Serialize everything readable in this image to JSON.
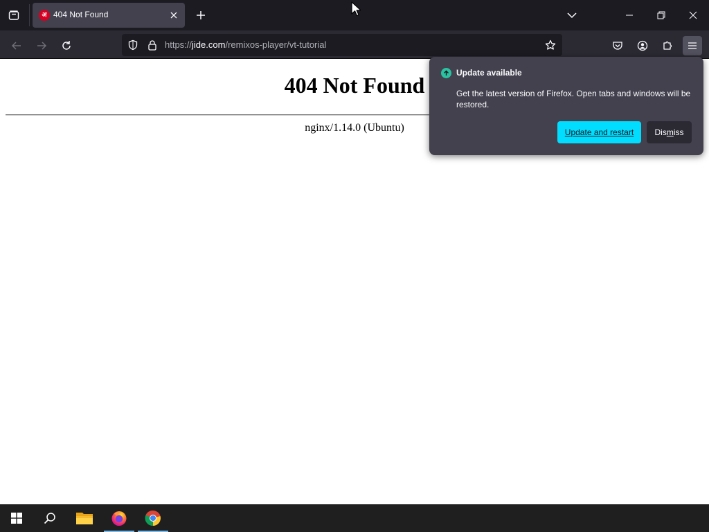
{
  "browser": {
    "tab": {
      "title": "404 Not Found",
      "favicon_glyph": "अ",
      "favicon_color": "#d70022"
    },
    "url": {
      "prefix": "https://",
      "host": "jide.com",
      "path": "/remixos-player/vt-tutorial"
    },
    "icons": {
      "tab_list": "tab-list-icon",
      "close_tab": "close-icon",
      "new_tab": "plus-icon",
      "list_all_tabs": "chevron-down-icon",
      "minimize": "minimize-icon",
      "restore": "restore-icon",
      "close_window": "close-icon",
      "back": "arrow-left-icon",
      "forward": "arrow-right-icon",
      "reload": "reload-icon",
      "tracking_protection": "shield-icon",
      "site_security": "lock-icon",
      "bookmark": "star-icon",
      "pocket": "pocket-icon",
      "account": "account-icon",
      "extensions": "puzzle-icon",
      "menu": "hamburger-icon"
    }
  },
  "page": {
    "heading": "404 Not Found",
    "server": "nginx/1.14.0 (Ubuntu)"
  },
  "update_panel": {
    "title": "Update available",
    "description": "Get the latest version of Firefox. Open tabs and windows will be restored.",
    "primary_button": "Update and restart",
    "secondary_button_pre": "Dis",
    "secondary_button_accel": "m",
    "secondary_button_post": "iss",
    "accent_color": "#00ddff",
    "icon_color": "#2ac3a2"
  },
  "taskbar": {
    "items": [
      {
        "name": "start",
        "icon": "windows-logo-icon"
      },
      {
        "name": "search",
        "icon": "search-icon"
      },
      {
        "name": "file-explorer",
        "icon": "folder-icon"
      },
      {
        "name": "firefox",
        "icon": "firefox-icon"
      },
      {
        "name": "chrome",
        "icon": "chrome-icon"
      }
    ]
  }
}
